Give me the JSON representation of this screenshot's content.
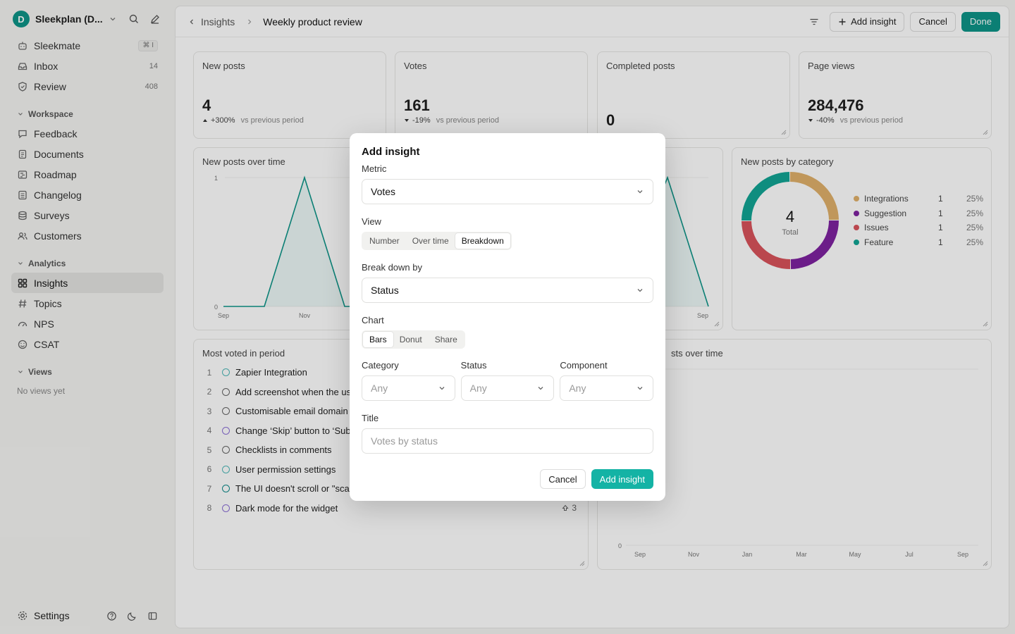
{
  "workspace": {
    "initial": "D",
    "name": "Sleekplan (D..."
  },
  "nav_top": [
    {
      "label": "Sleekmate",
      "badge": "⌘ I",
      "icon": "robot-icon"
    },
    {
      "label": "Inbox",
      "badge": "14",
      "icon": "inbox-icon"
    },
    {
      "label": "Review",
      "badge": "408",
      "icon": "shield-icon"
    }
  ],
  "sections": {
    "workspace": "Workspace",
    "analytics": "Analytics",
    "views": "Views"
  },
  "nav_workspace": [
    {
      "label": "Feedback",
      "icon": "message-icon"
    },
    {
      "label": "Documents",
      "icon": "document-icon"
    },
    {
      "label": "Roadmap",
      "icon": "roadmap-icon"
    },
    {
      "label": "Changelog",
      "icon": "changelog-icon"
    },
    {
      "label": "Surveys",
      "icon": "survey-icon"
    },
    {
      "label": "Customers",
      "icon": "users-icon"
    }
  ],
  "nav_analytics": [
    {
      "label": "Insights",
      "icon": "grid-icon",
      "active": true
    },
    {
      "label": "Topics",
      "icon": "hash-icon"
    },
    {
      "label": "NPS",
      "icon": "gauge-icon"
    },
    {
      "label": "CSAT",
      "icon": "smile-icon"
    }
  ],
  "views_empty": "No views yet",
  "settings_label": "Settings",
  "breadcrumb": {
    "parent": "Insights",
    "current": "Weekly product review"
  },
  "top_actions": {
    "add": "Add insight",
    "cancel": "Cancel",
    "done": "Done"
  },
  "stats": [
    {
      "title": "New posts",
      "value": "4",
      "delta": "+300%",
      "dir": "up",
      "vs": "vs previous period"
    },
    {
      "title": "Votes",
      "value": "161",
      "delta": "-19%",
      "dir": "down",
      "vs": "vs previous period"
    },
    {
      "title": "Completed posts",
      "value": "0"
    },
    {
      "title": "Page views",
      "value": "284,476",
      "delta": "-40%",
      "dir": "down",
      "vs": "vs previous period"
    }
  ],
  "card_titles": {
    "new_posts_over_time": "New posts over time",
    "by_category": "New posts by category",
    "most_voted": "Most voted in period",
    "posts_over_time_partial": "sts over time"
  },
  "line_chart": {
    "y_ticks": [
      "1",
      "0"
    ],
    "x_ticks_left": [
      "Sep",
      "Nov"
    ],
    "x_tick_right": "Sep"
  },
  "bottom_chart": {
    "y_tick": "0",
    "x_ticks": [
      "Sep",
      "Nov",
      "Jan",
      "Mar",
      "May",
      "Jul",
      "Sep"
    ]
  },
  "donut": {
    "total": "4",
    "total_label": "Total",
    "items": [
      {
        "label": "Integrations",
        "value": "1",
        "pct": "25%",
        "color": "#e0b06a"
      },
      {
        "label": "Suggestion",
        "value": "1",
        "pct": "25%",
        "color": "#7e22a0"
      },
      {
        "label": "Issues",
        "value": "1",
        "pct": "25%",
        "color": "#d9535b"
      },
      {
        "label": "Feature",
        "value": "1",
        "pct": "25%",
        "color": "#12a594"
      }
    ]
  },
  "most_voted": [
    {
      "n": "1",
      "title": "Zapier Integration",
      "color": "#4fb8b8"
    },
    {
      "n": "2",
      "title": "Add screenshot when the us",
      "color": "#666"
    },
    {
      "n": "3",
      "title": "Customisable email domain",
      "color": "#666"
    },
    {
      "n": "4",
      "title": "Change ‘Skip’ button to ‘Sub",
      "color": "#8b6fd6"
    },
    {
      "n": "5",
      "title": "Checklists in comments",
      "color": "#666"
    },
    {
      "n": "6",
      "title": "User permission settings",
      "color": "#4fb8b8"
    },
    {
      "n": "7",
      "title": "The UI doesn't scroll or \"sca",
      "color": "#0d8a8a"
    },
    {
      "n": "8",
      "title": "Dark mode for the widget",
      "color": "#8b6fd6",
      "votes": "3"
    }
  ],
  "modal": {
    "title": "Add insight",
    "metric_label": "Metric",
    "metric_value": "Votes",
    "view_label": "View",
    "view_options": [
      "Number",
      "Over time",
      "Breakdown"
    ],
    "view_selected": "Breakdown",
    "breakdown_label": "Break down by",
    "breakdown_value": "Status",
    "chart_label": "Chart",
    "chart_options": [
      "Bars",
      "Donut",
      "Share"
    ],
    "chart_selected": "Bars",
    "filters": [
      {
        "label": "Category",
        "value": "Any"
      },
      {
        "label": "Status",
        "value": "Any"
      },
      {
        "label": "Component",
        "value": "Any"
      }
    ],
    "title_label": "Title",
    "title_placeholder": "Votes by status",
    "cancel": "Cancel",
    "submit": "Add insight"
  },
  "colors": {
    "accent": "#0d9488",
    "accent_button": "#14b3a5"
  }
}
